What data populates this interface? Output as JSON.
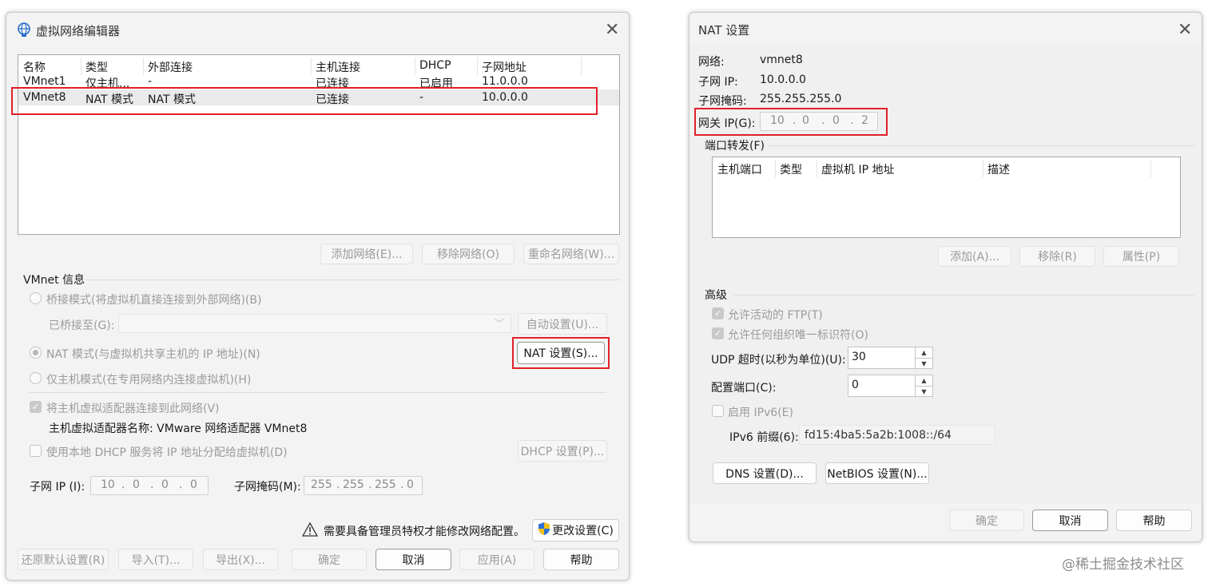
{
  "editor": {
    "title": "虚拟网络编辑器",
    "columns": [
      "名称",
      "类型",
      "外部连接",
      "主机连接",
      "DHCP",
      "子网地址"
    ],
    "rows": [
      [
        "VMnet1",
        "仅主机...",
        "-",
        "已连接",
        "已启用",
        "11.0.0.0"
      ],
      [
        "VMnet8",
        "NAT 模式",
        "NAT 模式",
        "已连接",
        "-",
        "10.0.0.0"
      ]
    ],
    "add_network": "添加网络(E)...",
    "remove_network": "移除网络(O)",
    "rename_network": "重命名网络(W)...",
    "vmnet_info_label": "VMnet 信息",
    "bridge_mode": "桥接模式(将虚拟机直接连接到外部网络)(B)",
    "bridged_to_label": "已桥接至(G):",
    "auto_settings": "自动设置(U)...",
    "nat_mode": "NAT 模式(与虚拟机共享主机的 IP 地址)(N)",
    "nat_settings": "NAT 设置(S)...",
    "host_only_mode": "仅主机模式(在专用网络内连接虚拟机)(H)",
    "connect_adapter": "将主机虚拟适配器连接到此网络(V)",
    "adapter_name": "主机虚拟适配器名称: VMware 网络适配器 VMnet8",
    "use_dhcp": "使用本地 DHCP 服务将 IP 地址分配给虚拟机(D)",
    "dhcp_settings": "DHCP 设置(P)...",
    "subnet_ip_label": "子网 IP (I):",
    "subnet_ip": [
      "10",
      "0",
      "0",
      "0"
    ],
    "subnet_mask_label": "子网掩码(M):",
    "subnet_mask": [
      "255",
      "255",
      "255",
      "0"
    ],
    "admin_notice": "需要具备管理员特权才能修改网络配置。",
    "change_settings": "更改设置(C)",
    "restore_defaults": "还原默认设置(R)",
    "import": "导入(T)...",
    "export": "导出(X)...",
    "ok": "确定",
    "cancel": "取消",
    "apply": "应用(A)",
    "help": "帮助"
  },
  "nat": {
    "title": "NAT 设置",
    "network_label": "网络:",
    "network_value": "vmnet8",
    "subnet_ip_label": "子网 IP:",
    "subnet_ip_value": "10.0.0.0",
    "subnet_mask_label": "子网掩码:",
    "subnet_mask_value": "255.255.255.0",
    "gateway_label": "网关 IP(G):",
    "gateway_ip": [
      "10",
      "0",
      "0",
      "2"
    ],
    "port_forwarding_label": "端口转发(F)",
    "pf_columns": [
      "主机端口",
      "类型",
      "虚拟机 IP 地址",
      "描述"
    ],
    "add": "添加(A)...",
    "remove": "移除(R)",
    "properties": "属性(P)",
    "advanced_label": "高级",
    "allow_ftp": "允许活动的 FTP(T)",
    "allow_oui": "允许任何组织唯一标识符(O)",
    "udp_timeout_label": "UDP 超时(以秒为单位)(U):",
    "udp_timeout_value": "30",
    "config_port_label": "配置端口(C):",
    "config_port_value": "0",
    "enable_ipv6": "启用 IPv6(E)",
    "ipv6_prefix_label": "IPv6 前缀(6):",
    "ipv6_prefix_value": "fd15:4ba5:5a2b:1008::/64",
    "dns_settings": "DNS 设置(D)...",
    "netbios_settings": "NetBIOS 设置(N)...",
    "ok": "确定",
    "cancel": "取消",
    "help": "帮助"
  },
  "watermark": "@稀土掘金技术社区",
  "colors": {
    "highlight_red": "#e0202a",
    "selected_row": "#eaeaea"
  }
}
